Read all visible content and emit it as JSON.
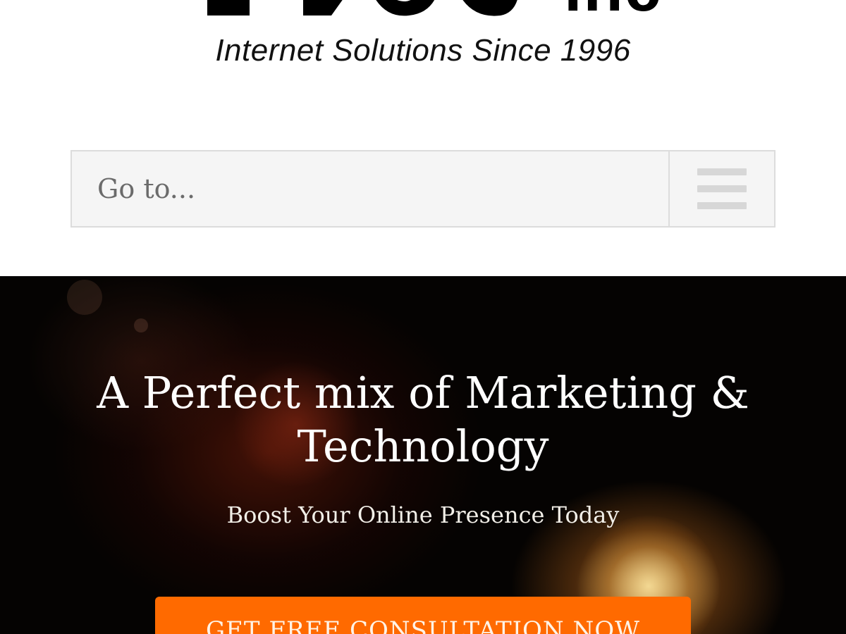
{
  "header": {
    "logo": {
      "wordmark": "inc",
      "tagline": "Internet Solutions Since 1996"
    }
  },
  "nav": {
    "select_label": "Go to...",
    "toggle_icon": "hamburger-menu-icon"
  },
  "hero": {
    "title": "A Perfect mix of Marketing & Technology",
    "subtitle": "Boost Your Online Presence Today",
    "cta_label": "GET FREE CONSULTATION NOW"
  },
  "colors": {
    "cta_background": "#ff6a00",
    "hero_background": "#050302",
    "nav_background": "#f5f5f5"
  }
}
